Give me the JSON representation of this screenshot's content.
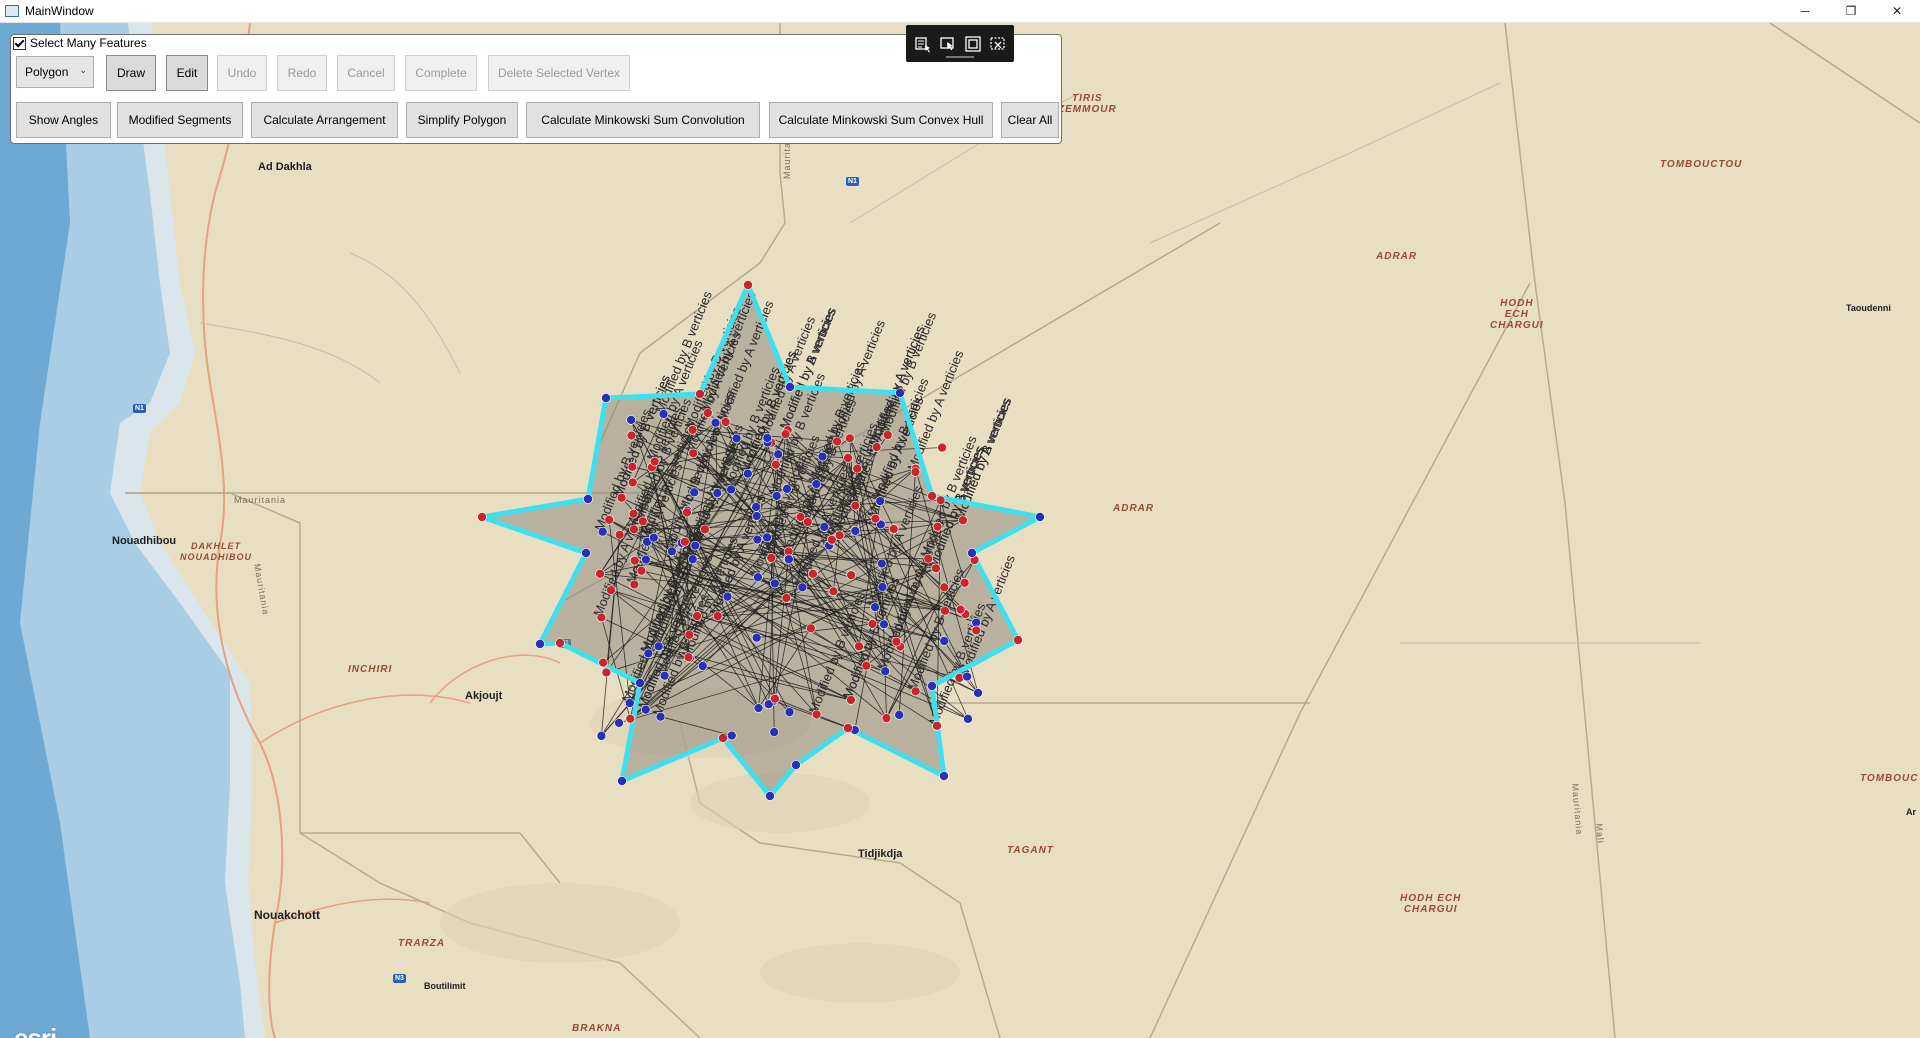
{
  "window": {
    "title": "MainWindow",
    "controls": {
      "minimize": "─",
      "restore": "❐",
      "close": "✕"
    }
  },
  "toolbar": {
    "select_many_label": "Select Many Features",
    "select_many_checked": true,
    "mode_selected": "Polygon",
    "row1": [
      {
        "id": "draw",
        "label": "Draw",
        "enabled": true,
        "active": true
      },
      {
        "id": "edit",
        "label": "Edit",
        "enabled": true,
        "active": true
      },
      {
        "id": "undo",
        "label": "Undo",
        "enabled": false
      },
      {
        "id": "redo",
        "label": "Redo",
        "enabled": false
      },
      {
        "id": "cancel",
        "label": "Cancel",
        "enabled": false
      },
      {
        "id": "complete",
        "label": "Complete",
        "enabled": false
      },
      {
        "id": "delete_vertex",
        "label": "Delete Selected Vertex",
        "enabled": false
      }
    ],
    "row2": [
      {
        "id": "show_angles",
        "label": "Show Angles"
      },
      {
        "id": "modified_segments",
        "label": "Modified Segments"
      },
      {
        "id": "calculate_arrangement",
        "label": "Calculate Arrangement"
      },
      {
        "id": "simplify_polygon",
        "label": "Simplify Polygon"
      },
      {
        "id": "minkowski_convolution",
        "label": "Calculate Minkowski Sum Convolution"
      },
      {
        "id": "minkowski_convex_hull",
        "label": "Calculate Minkowski Sum Convex Hull"
      },
      {
        "id": "clear_all",
        "label": "Clear All"
      }
    ]
  },
  "floating_toolbar": {
    "icons": [
      "select-by-attributes-icon",
      "select-cursor-icon",
      "frame-select-icon",
      "clear-selection-icon"
    ]
  },
  "map": {
    "places": [
      {
        "name": "Ad Dakhla"
      },
      {
        "name": "Nouadhibou"
      },
      {
        "name": "Akjoujt"
      },
      {
        "name": "Nouakchott"
      },
      {
        "name": "Boutilimit"
      },
      {
        "name": "Tidjikdja"
      },
      {
        "name": "Taoudenni"
      },
      {
        "name": "Ar"
      }
    ],
    "regions": [
      {
        "name": "TIRIS\nZEMMOUR"
      },
      {
        "name": "TOMBOUCTOU"
      },
      {
        "name": "ADRAR"
      },
      {
        "name": "HODH\nECH\nCHARGUI"
      },
      {
        "name": "ADRAR"
      },
      {
        "name": "DAKHLET\nNOUADHIBOU"
      },
      {
        "name": "INCHIRI"
      },
      {
        "name": "TAGANT"
      },
      {
        "name": "HODH ECH\nCHARGUI"
      },
      {
        "name": "TRARZA"
      },
      {
        "name": "BRAKNA"
      },
      {
        "name": "TOMBOUC"
      }
    ],
    "country_labels": [
      "Mauritania",
      "Mauritania",
      "Mauritania",
      "Mauritania",
      "Mali"
    ],
    "road_shields": [
      "N1",
      "N1",
      "N1",
      "N3"
    ],
    "attribution_logo": "esri",
    "vertex_labels": [
      "Modified by A verticies",
      "Modified by B verticies"
    ],
    "colors": {
      "polygon_outline": "#3fe0ee",
      "polygon_fill": "#8f8a80",
      "vertex_a": "#c8262c",
      "vertex_b": "#2b2fb8",
      "ocean_dark": "#6ea9d4",
      "ocean_light": "#cfe2ee",
      "land": "#e8dfc3",
      "border": "#b9a98f",
      "road": "#e89f83"
    }
  }
}
